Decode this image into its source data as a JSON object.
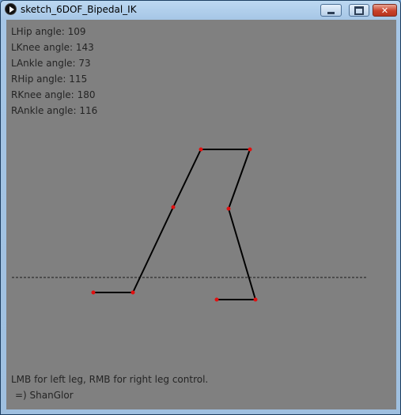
{
  "window": {
    "title": "sketch_6DOF_Bipedal_IK",
    "controls": {
      "minimize": "minimize",
      "maximize": "maximize",
      "close": "✕"
    }
  },
  "readouts": [
    {
      "label": "LHip angle:",
      "value": "109"
    },
    {
      "label": "LKnee angle:",
      "value": "143"
    },
    {
      "label": "LAnkle angle:",
      "value": "73"
    },
    {
      "label": "RHip angle:",
      "value": "115"
    },
    {
      "label": "RKnee angle:",
      "value": "180"
    },
    {
      "label": "RAnkle angle:",
      "value": "116"
    }
  ],
  "footer": {
    "instructions": "LMB for left leg, RMB for right leg control.",
    "credit": " =) ShanGlor"
  },
  "colors": {
    "background": "#808080",
    "joint": "#e01010",
    "segment": "#000000",
    "ground": "#1a1a1a"
  }
}
